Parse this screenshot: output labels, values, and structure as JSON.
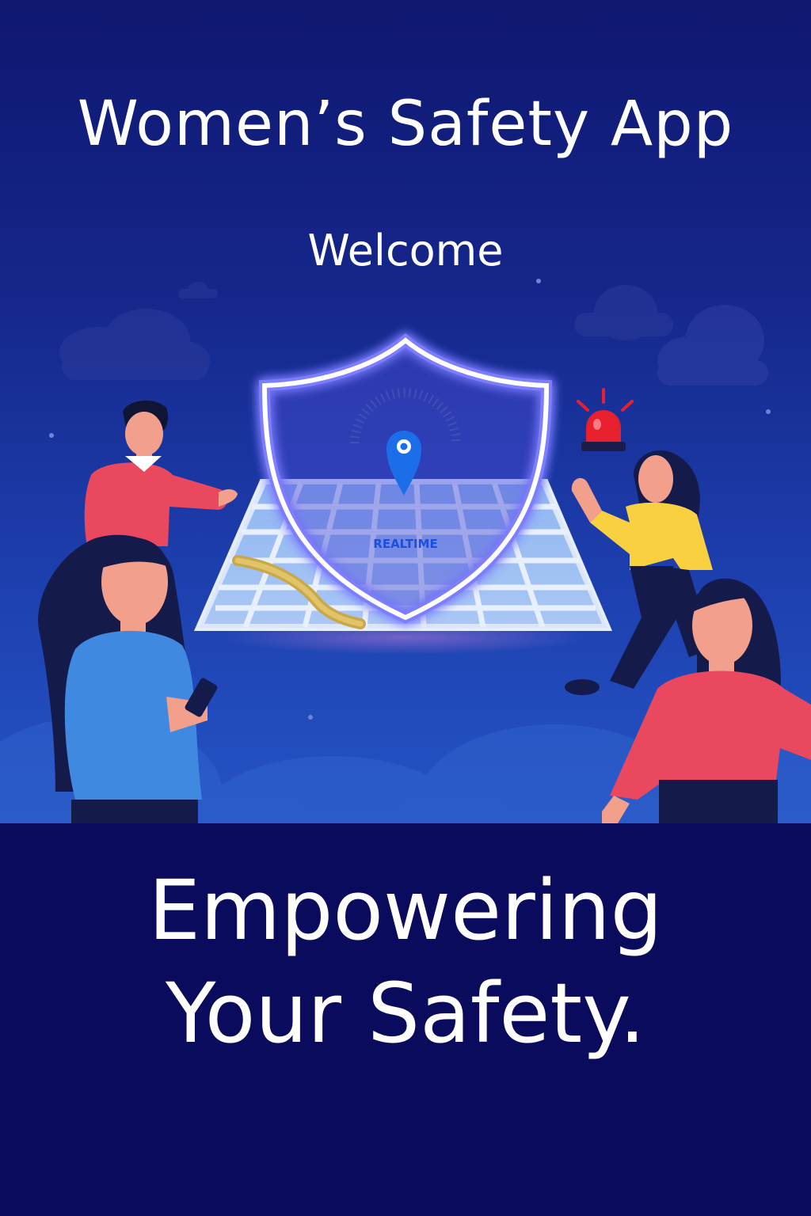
{
  "header": {
    "title": "Women’s Safety App",
    "subtitle": "Welcome"
  },
  "illustration": {
    "map_label": "REALTIME",
    "icons": [
      "shield-icon",
      "location-pin-icon",
      "alarm-siren-icon",
      "phone-icon",
      "cloud-icon"
    ]
  },
  "tagline": {
    "line1": "Empowering",
    "line2": "Your Safety."
  },
  "colors": {
    "background_top": "#0f1770",
    "background_bottom": "#2554c6",
    "footer": "#0a0b5c",
    "shield_glow": "#6a6cff",
    "alarm_red": "#e8202e",
    "pin_blue": "#1c6ee8"
  }
}
